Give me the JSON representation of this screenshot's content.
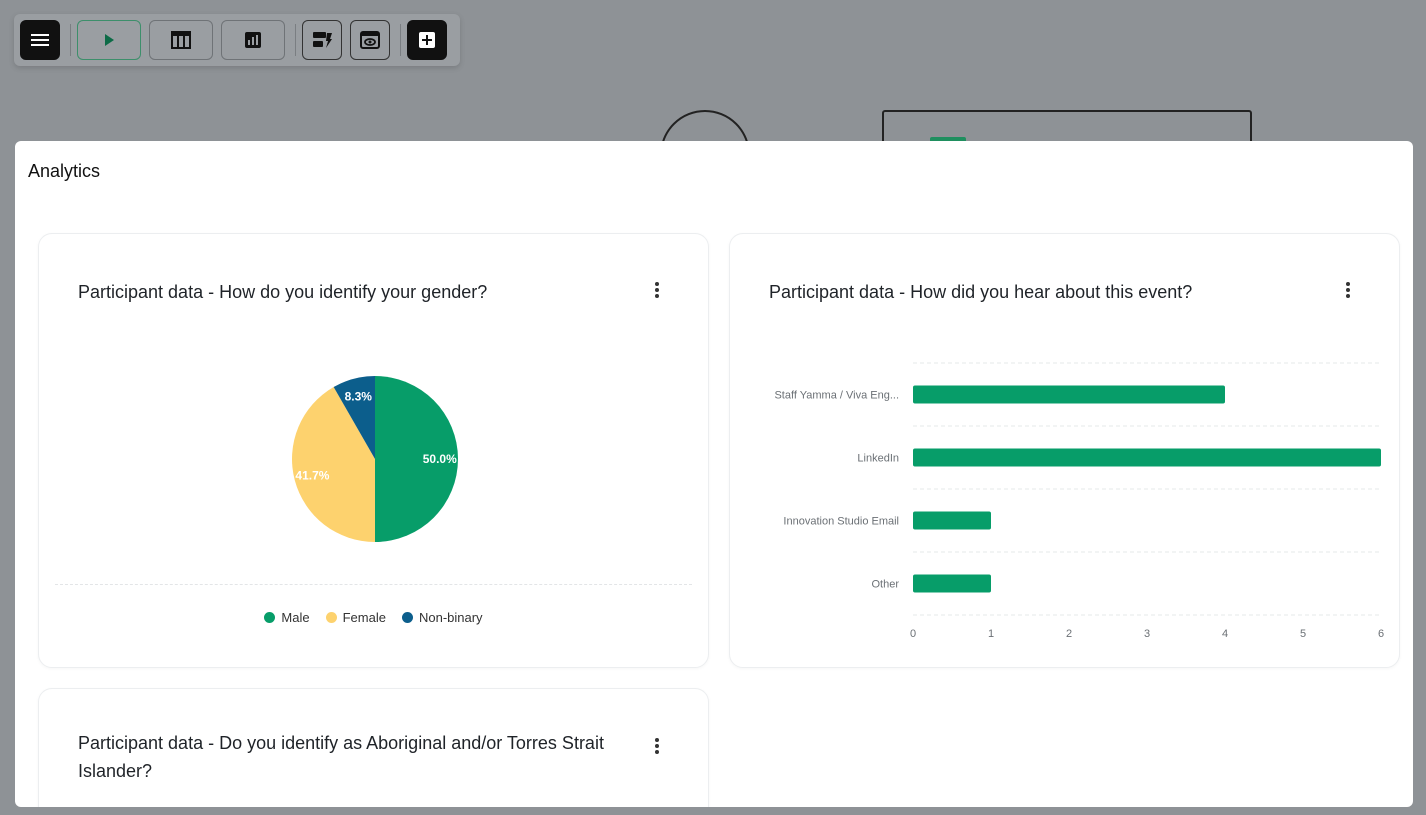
{
  "modal": {
    "title": "Analytics"
  },
  "cards": {
    "gender": {
      "title": "Participant data - How do you identify your gender?"
    },
    "hear": {
      "title": "Participant data - How did you hear about this event?"
    },
    "aboriginal": {
      "title": "Participant data - Do you identify as Aboriginal and/or Torres Strait Islander?"
    }
  },
  "chart_data": [
    {
      "type": "pie",
      "labels": [
        "Male",
        "Female",
        "Non-binary"
      ],
      "values": [
        50.0,
        41.7,
        8.3
      ],
      "data_labels": [
        "50.0%",
        "41.7%",
        "8.3%"
      ],
      "colors": [
        "#079d69",
        "#fdd26e",
        "#0c5e8c"
      ],
      "legend": "bottom"
    },
    {
      "type": "bar",
      "orientation": "horizontal",
      "categories": [
        "Staff Yamma / Viva Eng...",
        "LinkedIn",
        "Innovation Studio Email",
        "Other"
      ],
      "values": [
        4,
        6,
        1,
        1
      ],
      "xlim": [
        0,
        6
      ],
      "xticks": [
        "0",
        "1",
        "2",
        "3",
        "4",
        "5",
        "6"
      ],
      "color": "#079d69",
      "grid": true
    }
  ],
  "icons": {
    "toolbar": [
      "menu-icon",
      "play-icon",
      "table-icon",
      "bar-chart-icon",
      "layout-icon",
      "preview-icon",
      "add-icon"
    ]
  }
}
